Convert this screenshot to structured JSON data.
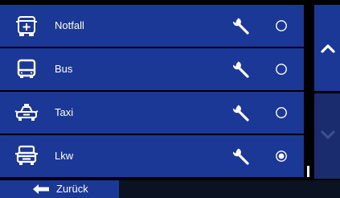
{
  "vehicles": [
    {
      "label": "Notfall",
      "icon": "ambulance-icon",
      "selected": false
    },
    {
      "label": "Bus",
      "icon": "bus-icon",
      "selected": false
    },
    {
      "label": "Taxi",
      "icon": "taxi-icon",
      "selected": false
    },
    {
      "label": "Lkw",
      "icon": "truck-icon",
      "selected": true
    }
  ],
  "footer": {
    "back_label": "Zurück",
    "back_icon": "arrow-left-icon"
  },
  "scroll": {
    "up_icon": "chevron-up-icon",
    "down_icon": "chevron-down-icon",
    "up_enabled": true,
    "down_enabled": false
  },
  "colors": {
    "row_background": "#1c3896",
    "disabled_button": "#1a2c6e",
    "background": "#000000",
    "footer_background": "#0b1221",
    "foreground": "#ffffff"
  }
}
